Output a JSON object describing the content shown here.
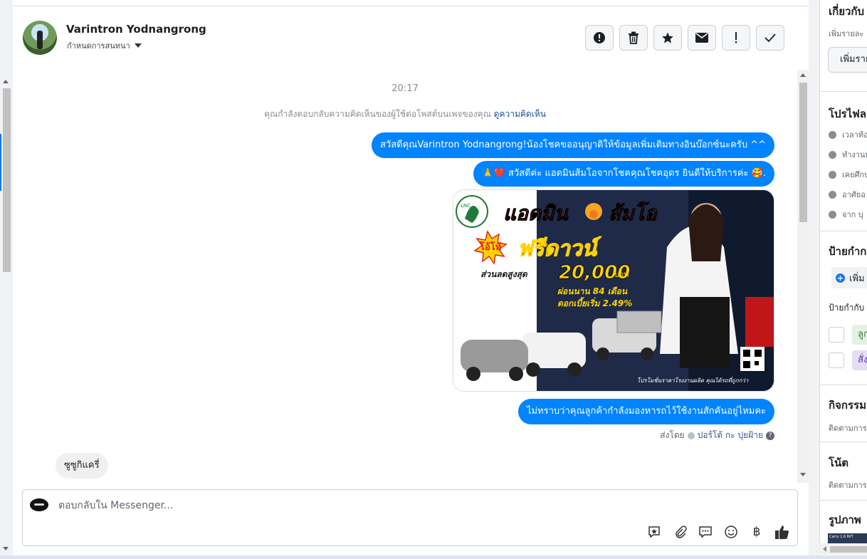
{
  "header": {
    "user_name": "Varintron Yodnangrong",
    "assign_label": "กำหนดการสนทนา",
    "actions": [
      {
        "icon": "alert-circle-icon",
        "glyph": "!"
      },
      {
        "icon": "trash-icon",
        "glyph": "🗑"
      },
      {
        "icon": "star-icon",
        "glyph": "★"
      },
      {
        "icon": "envelope-icon",
        "glyph": "✉"
      },
      {
        "icon": "exclamation-icon",
        "glyph": "!"
      },
      {
        "icon": "check-icon",
        "glyph": "✓"
      }
    ]
  },
  "conversation": {
    "time": "20:17",
    "notice_text": "คุณกำลังตอบกลับความคิดเห็นของผู้ใช้ต่อโพสต์บนเพจของคุณ",
    "notice_link": "ดูความคิดเห็น",
    "out_msg_1": "สวัสดีคุณVarintron Yodnangrong!น้องโชคขออนุญาติให้ข้อมูลเพิ่มเติมทางอินบ๊อกซ์นะครับ ^^",
    "out_msg_2": "🙏❤️ สวัสดีค่ะ แอดมินส้มโอจากโชคคุณโชคอุดร ยินดีให้บริการค่ะ 🥰.",
    "out_msg_3": "ไม่ทราบว่าคุณลูกค้ากำลังมองหารถไว้ใช้งานสักคันอยู่ไหมคะ",
    "sent_by_label": "ส่งโดย",
    "sent_by_name": "ปอร์โต้ กะ ปุยฝ้าย",
    "help_glyph": "?",
    "in_msg_1": "ซูซูกิแครี่",
    "promo": {
      "title_1": "แอดมิน",
      "title_2": "ส้มโอ",
      "give_label": "โอ้โห้",
      "free_down": "ฟรีดาวน์",
      "discount_label": "ส่วนลดสูงสุด",
      "discount_value": "20,000",
      "currency": "บาท",
      "installment": "ผ่อนนาน 84 เดือน",
      "interest": "ดอกเบี้ยเริ่ม 2.49%",
      "footer": "โปรโมชั่นราคาโรงงานผลิต คุณได้รถที่ถูกกว่า",
      "accent_red": "#e0201b",
      "accent_yellow": "#ffd400"
    }
  },
  "composer": {
    "placeholder": "ตอบกลับใน Messenger...",
    "icons": [
      {
        "icon": "saved-reply-icon",
        "glyph": "⭐"
      },
      {
        "icon": "attachment-icon",
        "glyph": "📎"
      },
      {
        "icon": "chat-bubble-icon",
        "glyph": "💬"
      },
      {
        "icon": "emoji-icon",
        "glyph": "☺"
      },
      {
        "icon": "baht-icon",
        "glyph": "฿"
      },
      {
        "icon": "thumbs-up-icon",
        "glyph": "👍"
      }
    ]
  },
  "sidebar": {
    "about_title": "เกี่ยวกับ",
    "about_sub": "เพิ่มรายละ",
    "about_btn": "เพิ่มราย",
    "profile_title": "โปรไฟล",
    "profile_rows": [
      "เวลาท้อ",
      "ทำงานท",
      "เคยศึกษ",
      "อาศัยอ",
      "จาก บุ"
    ],
    "labels_title": "ป้ายกำก",
    "add_label": "เพิ่ม",
    "labels_sub": "ป้ายกำกับ",
    "tag_1": "ลูก",
    "tag_2": "สั่ง",
    "activity_title": "กิจกรรม",
    "activity_sub": "ติดตามการ",
    "notes_title": "โน้ต",
    "notes_sub": "ติดตามการ",
    "photos_title": "รูปภาพ",
    "photo_caption": "Carry 1.6 M/T"
  }
}
